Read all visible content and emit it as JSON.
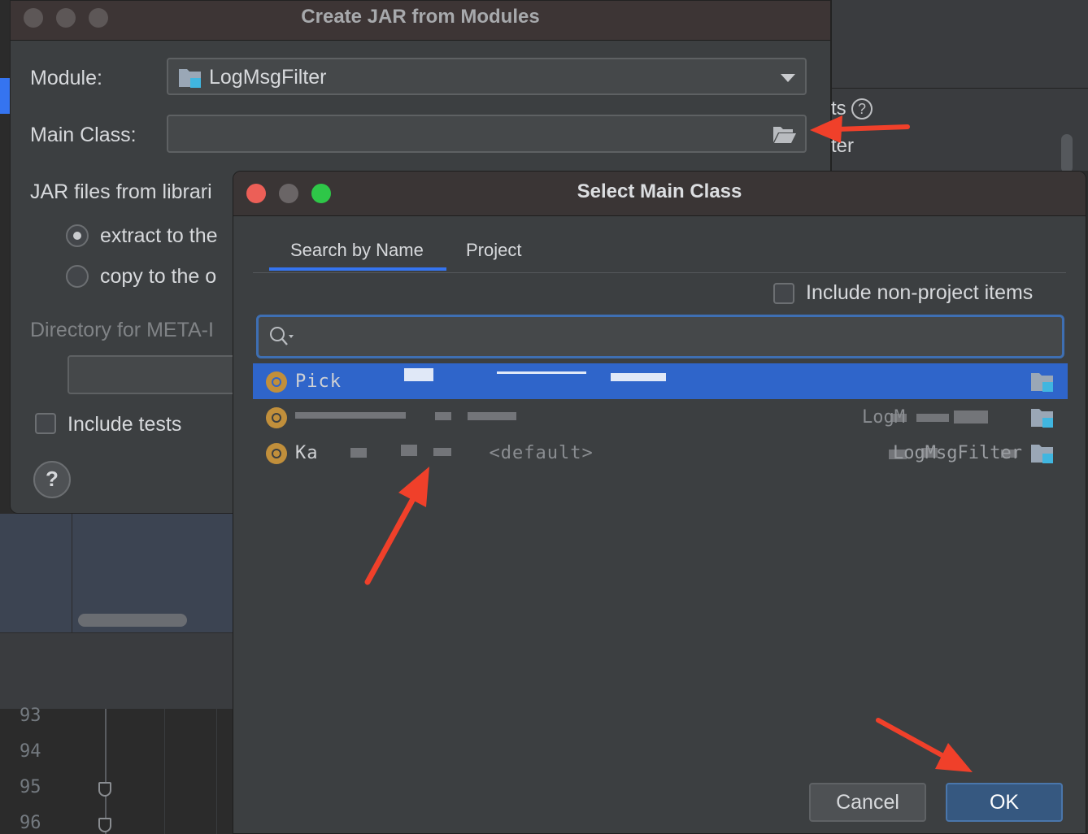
{
  "ide": {
    "partial_texts": [
      "ts",
      "ter"
    ],
    "line_numbers": [
      "93",
      "94",
      "95",
      "96"
    ]
  },
  "jar_dialog": {
    "title": "Create JAR from Modules",
    "module_label": "Module:",
    "module_value": "LogMsgFilter",
    "main_class_label": "Main Class:",
    "main_class_value": "",
    "jar_files_label": "JAR files from librari",
    "radio_extract": "extract to the",
    "radio_copy": "copy to the o",
    "meta_dir_label": "Directory for META-I",
    "include_tests_label": "Include tests",
    "help": "?"
  },
  "select_dialog": {
    "title": "Select Main Class",
    "tabs": [
      "Search by Name",
      "Project"
    ],
    "include_non_project_label": "Include non-project items",
    "search_value": "",
    "rows": [
      {
        "name": "Pick",
        "package": "",
        "module": ""
      },
      {
        "name": "",
        "package": "",
        "module": "LogM"
      },
      {
        "name": "Ka",
        "package": "<default>",
        "module": "LogMsgFilter"
      }
    ],
    "cancel_label": "Cancel",
    "ok_label": "OK"
  },
  "colors": {
    "accent": "#3574f0",
    "selection": "#2f65ca",
    "annotation_arrow": "#f0402a",
    "class_icon": "#c18f3b"
  }
}
